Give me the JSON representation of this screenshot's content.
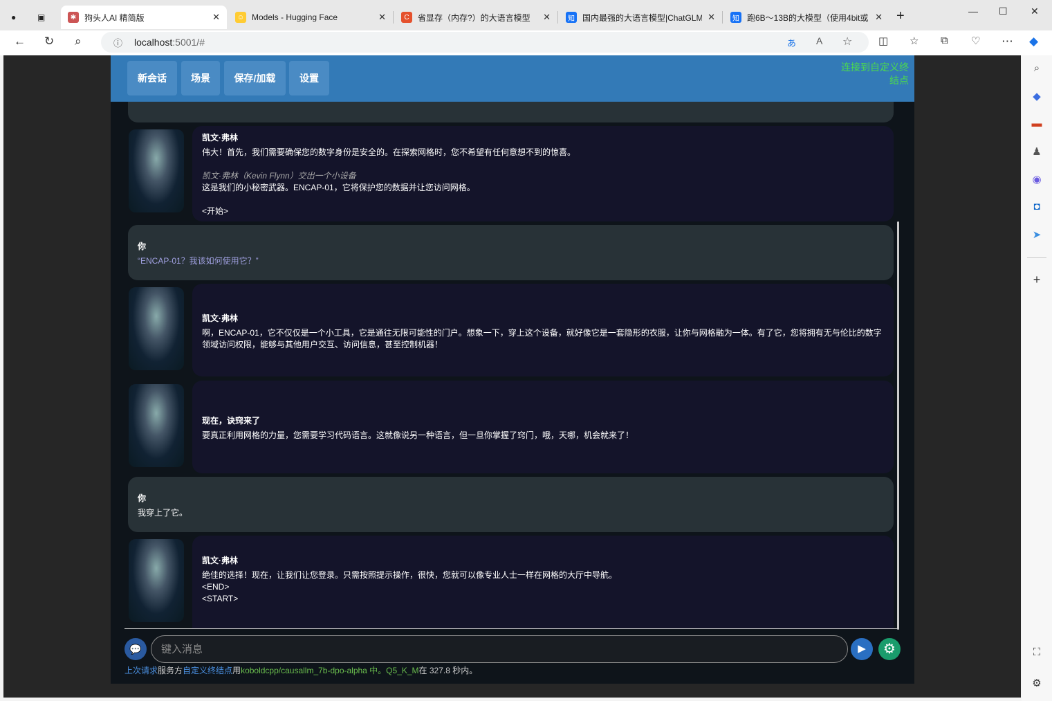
{
  "browser": {
    "tabs": [
      {
        "title": "狗头人AI 精简版",
        "active": true
      },
      {
        "title": "Models - Hugging Face"
      },
      {
        "title": "省显存（内存?）的大语言模型"
      },
      {
        "title": "国内最强的大语言模型|ChatGLM"
      },
      {
        "title": "跑6B～13B的大模型（使用4bit或"
      }
    ],
    "url_host": "localhost",
    "url_rest": ":5001/#"
  },
  "header": {
    "buttons": [
      "新会话",
      "场景",
      "保存/加载",
      "设置"
    ],
    "connection": "连接到自定义终结点",
    "connection_color": "#4cdb4c",
    "color": "#337ab7"
  },
  "messages": [
    {
      "role": "ai",
      "name": "凯文·弗林",
      "line1": "伟大！首先，我们需要确保您的数字身份是安全的。在探索网格时，您不希望有任何意想不到的惊喜。",
      "action": "凯文·弗林（Kevin Flynn）交出一个小设备",
      "line2": "这是我们的小秘密武器。ENCAP-01，它将保护您的数据并让您访问网格。",
      "line3": "<开始>"
    },
    {
      "role": "user",
      "name": "你",
      "text": "“ENCAP-01？我该如何使用它？”"
    },
    {
      "role": "ai",
      "name": "凯文·弗林",
      "text": "啊，ENCAP-01，它不仅仅是一个小工具，它是通往无限可能性的门户。想象一下，穿上这个设备，就好像它是一套隐形的衣服，让你与网格融为一体。有了它，您将拥有无与伦比的数字领域访问权限，能够与其他用户交互、访问信息，甚至控制机器！"
    },
    {
      "role": "ai",
      "name": "现在，诀窍来了",
      "text": "要真正利用网格的力量，您需要学习代码语言。这就像说另一种语言，但一旦你掌握了窍门，哦，天哪，机会就来了！"
    },
    {
      "role": "user",
      "name": "你",
      "text": "我穿上了它。"
    },
    {
      "role": "ai",
      "name": "凯文·弗林",
      "line1": "绝佳的选择！现在，让我们让您登录。只需按照提示操作，很快，您就可以像专业人士一样在网格的大厅中导航。",
      "line2": "<END>",
      "line3": "<START>"
    }
  ],
  "input": {
    "placeholder": "键入消息"
  },
  "status": {
    "p1": "上次请求",
    "p2": "服务方",
    "p3": "自定义终结点",
    "p4": "用",
    "p5": "koboldcpp/causallm_7b-dpo-alpha 中。Q5_K_M",
    "p6": "在 327.8 秒内。"
  }
}
